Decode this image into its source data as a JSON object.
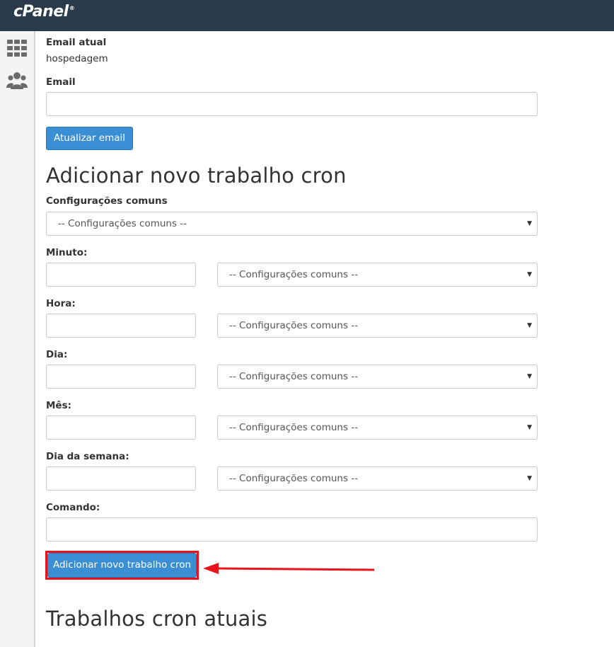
{
  "header": {
    "logo_text": "cPanel",
    "logo_mark": "®"
  },
  "sidebar": {
    "icons": [
      "grid-icon",
      "users-icon"
    ]
  },
  "email_section": {
    "current_email_label": "Email atual",
    "current_email_value": "hospedagem",
    "email_label": "Email",
    "email_value": "",
    "update_button": "Atualizar email"
  },
  "add_cron": {
    "title": "Adicionar novo trabalho cron",
    "common_settings_label": "Configurações comuns",
    "common_settings_selected": "-- Configurações comuns --",
    "fields": [
      {
        "label": "Minuto:",
        "value": "",
        "select": "-- Configurações comuns --"
      },
      {
        "label": "Hora:",
        "value": "",
        "select": "-- Configurações comuns --"
      },
      {
        "label": "Dia:",
        "value": "",
        "select": "-- Configurações comuns --"
      },
      {
        "label": "Mês:",
        "value": "",
        "select": "-- Configurações comuns --"
      },
      {
        "label": "Dia da semana:",
        "value": "",
        "select": "-- Configurações comuns --"
      }
    ],
    "command_label": "Comando:",
    "command_value": "",
    "submit_button": "Adicionar novo trabalho cron"
  },
  "current_crons": {
    "title": "Trabalhos cron atuais"
  },
  "annotation": {
    "highlight_color": "#e8141b",
    "arrow_color": "#e8141b"
  },
  "colors": {
    "topbar": "#293a4a",
    "button": "#3a8ed3"
  }
}
